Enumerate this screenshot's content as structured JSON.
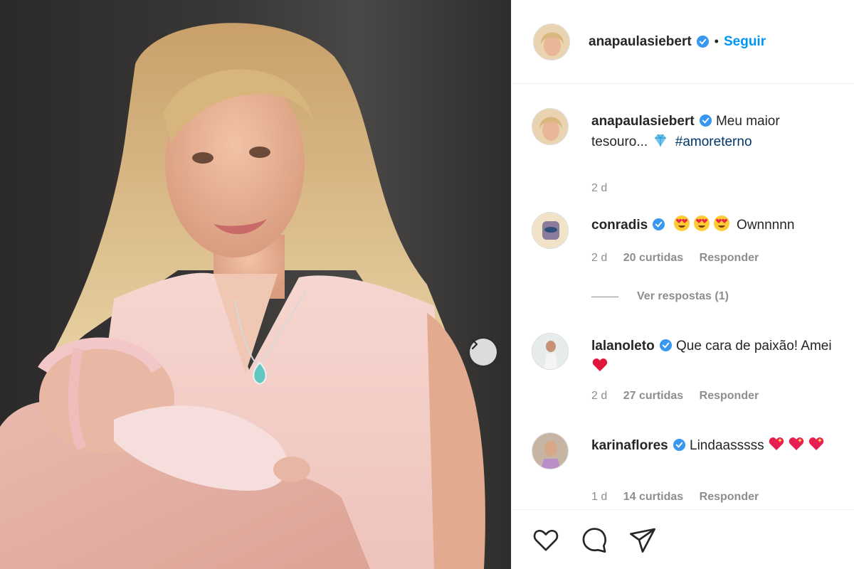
{
  "post": {
    "author": "anapaulasiebert",
    "follow_label": "Seguir",
    "separator": "•",
    "caption": {
      "username": "anapaulasiebert",
      "text_before": "Meu maior tesouro...",
      "emoji": "gem-emoji",
      "hashtag": "#amoreterno",
      "time": "2 d"
    }
  },
  "comments": [
    {
      "username": "conradis",
      "emojis": [
        "heart-eyes-emoji",
        "heart-eyes-emoji",
        "heart-eyes-emoji"
      ],
      "text": "Ownnnnn",
      "time": "2 d",
      "likes": "20 curtidas",
      "reply": "Responder",
      "view_replies": "Ver respostas (1)"
    },
    {
      "username": "lalanoleto",
      "text": "Que cara de paixão! Amei",
      "emojis": [
        "red-heart-emoji"
      ],
      "time": "2 d",
      "likes": "27 curtidas",
      "reply": "Responder"
    },
    {
      "username": "karinaflores",
      "text": "Lindaasssss",
      "emojis": [
        "sparkling-heart-emoji",
        "sparkling-heart-emoji",
        "sparkling-heart-emoji"
      ],
      "time": "1 d",
      "likes": "14 curtidas",
      "reply": "Responder"
    }
  ],
  "icons": [
    "verified-badge-icon",
    "chevron-right-icon",
    "heart-icon",
    "comment-icon",
    "share-icon"
  ],
  "colors": {
    "link": "#0095f6",
    "hashtag": "#00376b",
    "muted": "#8e8e8e",
    "verified": "#3897f0"
  }
}
